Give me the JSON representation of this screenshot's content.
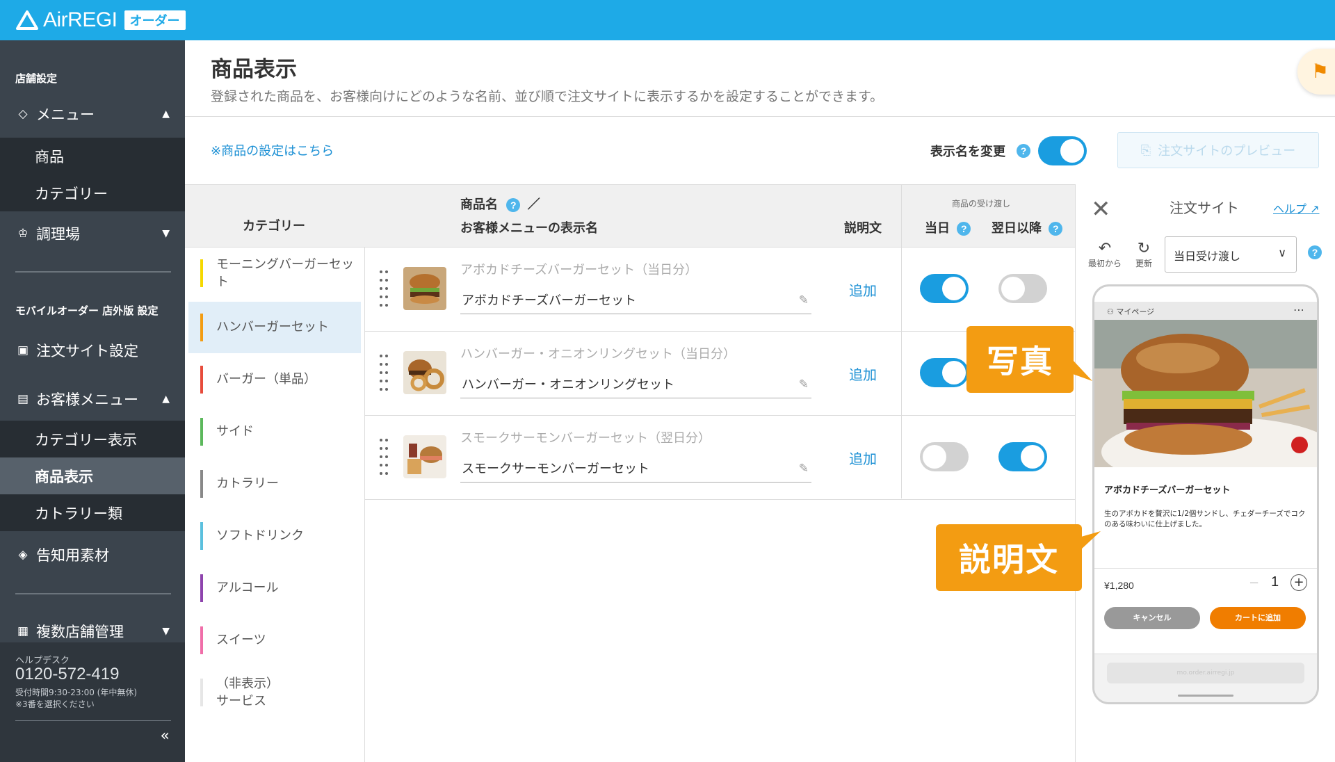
{
  "header": {
    "logo_text": "AirREGI",
    "logo_badge": "オーダー"
  },
  "sidebar": {
    "section_store": "店舗設定",
    "menu": "メニュー",
    "menu_sub": [
      "商品",
      "カテゴリー"
    ],
    "kitchen": "調理場",
    "section_mobile": "モバイルオーダー 店外版 設定",
    "order_site": "注文サイト設定",
    "customer_menu": "お客様メニュー",
    "customer_sub": [
      "カテゴリー表示",
      "商品表示",
      "カトラリー類"
    ],
    "promo": "告知用素材",
    "multi_store": "複数店舗管理",
    "helpdesk_label": "ヘルプデスク",
    "helpdesk_phone": "0120-572-419",
    "helpdesk_hours1": "受付時間9:30-23:00 (年中無休)",
    "helpdesk_hours2": "※3番を選択ください",
    "collapse": "«"
  },
  "main": {
    "title": "商品表示",
    "description": "登録された商品を、お客様向けにどのような名前、並び順で注文サイトに表示するかを設定することができます。",
    "setting_link_prefix": "※",
    "setting_link": "商品の設定はこちら",
    "rename_label": "表示名を変更",
    "rename_on": true,
    "preview_button": "注文サイトのプレビュー"
  },
  "table": {
    "col_category": "カテゴリー",
    "col_name_line1": "商品名",
    "col_name_sep": "／",
    "col_name_line2": "お客様メニューの表示名",
    "col_desc": "説明文",
    "col_receive": "商品の受け渡し",
    "col_today": "当日",
    "col_next": "翌日以降",
    "categories": [
      {
        "label": "モーニングバーガーセット",
        "color": "#f5d800"
      },
      {
        "label": "ハンバーガーセット",
        "color": "#f39c12",
        "active": true
      },
      {
        "label": "バーガー（単品）",
        "color": "#e74c3c"
      },
      {
        "label": "サイド",
        "color": "#5cb85c"
      },
      {
        "label": "カトラリー",
        "color": "#888888"
      },
      {
        "label": "ソフトドリンク",
        "color": "#5bc0de"
      },
      {
        "label": "アルコール",
        "color": "#8e44ad"
      },
      {
        "label": "スイーツ",
        "color": "#f06ea9"
      },
      {
        "label": "（非表示）\nサービス",
        "color": "#e6e6e6"
      }
    ],
    "rows": [
      {
        "orig_name": "アボカドチーズバーガーセット（当日分）",
        "display_name": "アボカドチーズバーガーセット",
        "desc_action": "追加",
        "today": true,
        "next": false
      },
      {
        "orig_name": "ハンバーガー・オニオンリングセット（当日分）",
        "display_name": "ハンバーガー・オニオンリングセット",
        "desc_action": "追加",
        "today": true,
        "next": false
      },
      {
        "orig_name": "スモークサーモンバーガーセット（翌日分）",
        "display_name": "スモークサーモンバーガーセット",
        "desc_action": "追加",
        "today": false,
        "next": true
      }
    ]
  },
  "preview": {
    "title": "注文サイト",
    "help": "ヘルプ",
    "reset": "最初から",
    "refresh": "更新",
    "select_value": "当日受け渡し",
    "phone": {
      "mypage": "マイページ",
      "product_name": "アボカドチーズバーガーセット",
      "product_desc": "生のアボカドを贅沢に1/2個サンドし、チェダーチーズでコクのある味わいに仕上げました。",
      "price": "¥1,280",
      "minus": "−",
      "qty": "1",
      "plus": "+",
      "cancel": "キャンセル",
      "add_to_cart": "カートに追加",
      "url": "mo.order.airregi.jp"
    }
  },
  "callouts": {
    "photo": "写真",
    "description": "説明文"
  },
  "colors": {
    "brand": "#1eaae7",
    "sidebar": "#3b444d",
    "toggle_on": "#1a9de0",
    "callout": "#f39c12",
    "link": "#1a8fd4"
  }
}
